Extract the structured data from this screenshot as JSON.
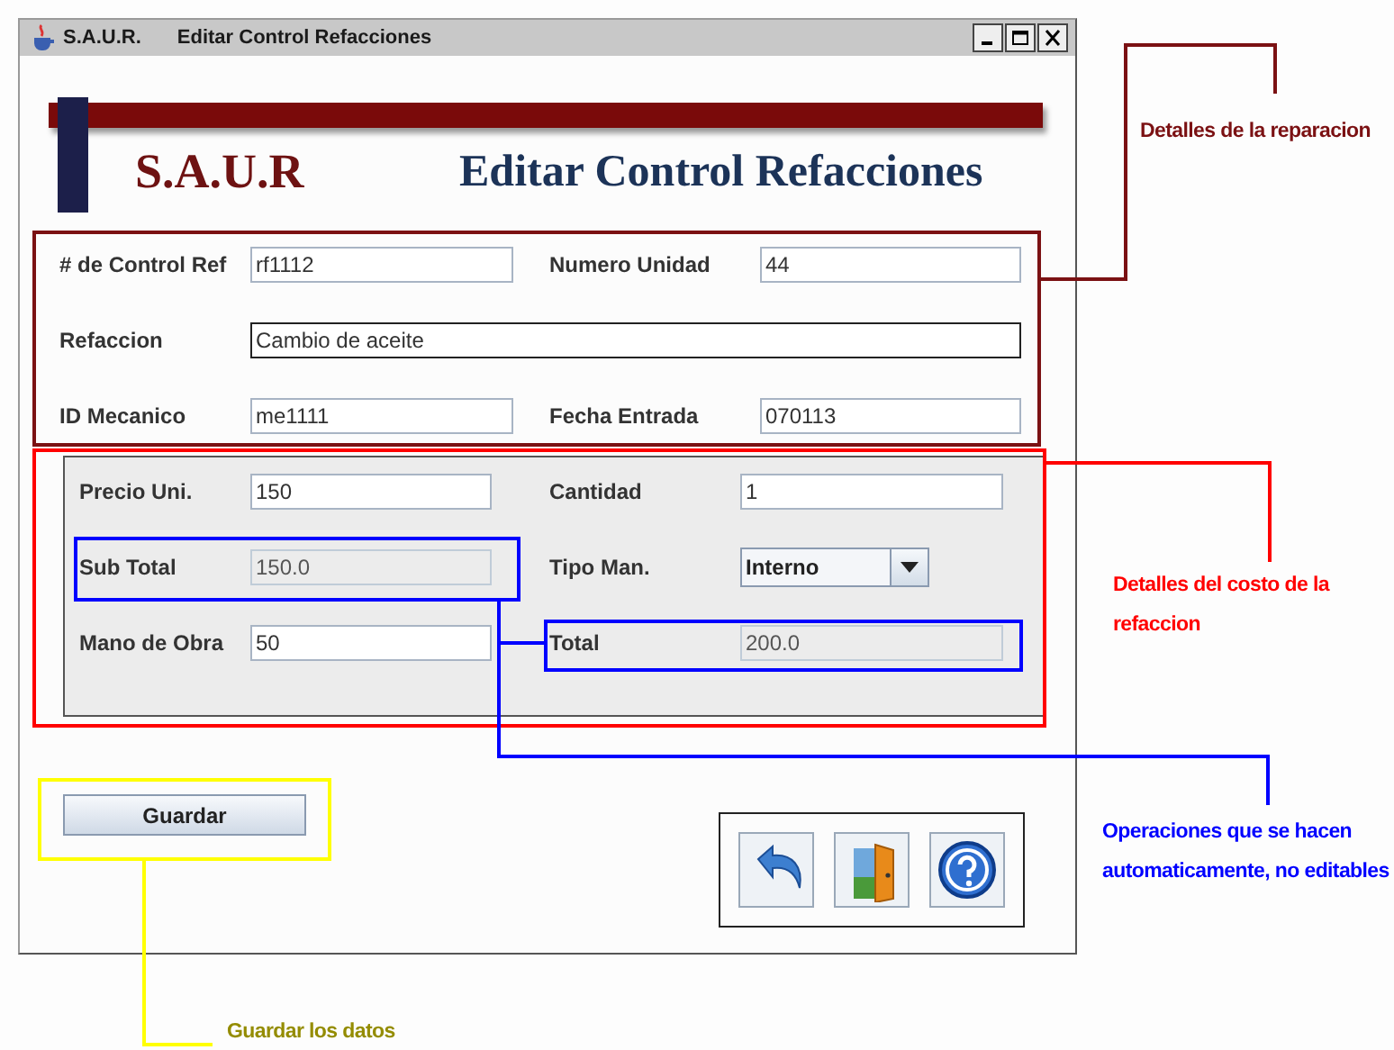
{
  "window": {
    "app": "S.A.U.R.",
    "title": "Editar Control Refacciones"
  },
  "banner": {
    "logo": "S.A.U.R",
    "heading": "Editar Control Refacciones"
  },
  "repair_details": [
    {
      "label": "# de Control Ref",
      "value": "rf1112",
      "kind": "text"
    },
    {
      "label": "Numero Unidad",
      "value": "44",
      "kind": "text"
    },
    {
      "label": "Refaccion",
      "value": "Cambio de aceite",
      "kind": "wide"
    },
    {
      "label": "ID Mecanico",
      "value": "me1111",
      "kind": "text"
    },
    {
      "label": "Fecha Entrada",
      "value": "070113",
      "kind": "text"
    }
  ],
  "cost_details": [
    {
      "label": "Precio Uni.",
      "value": "150",
      "kind": "text"
    },
    {
      "label": "Cantidad",
      "value": "1",
      "kind": "text"
    },
    {
      "label": "Sub Total",
      "value": "150.0",
      "kind": "readonly"
    },
    {
      "label": "Tipo Man.",
      "value": "Interno",
      "kind": "dropdown"
    },
    {
      "label": "Mano de Obra",
      "value": "50",
      "kind": "text"
    },
    {
      "label": "Total",
      "value": "200.0",
      "kind": "readonly"
    }
  ],
  "save_button": "Guardar",
  "annotations": [
    {
      "text": "Detalles de la reparacion",
      "color": "#7b1113"
    },
    {
      "text": "Detalles del costo de la refaccion",
      "color": "#ff0000"
    },
    {
      "text": "Operaciones que se hacen automaticamente, no editables",
      "color": "#0000ff"
    },
    {
      "text": "Guardar los datos",
      "color": "#ffff00"
    }
  ]
}
